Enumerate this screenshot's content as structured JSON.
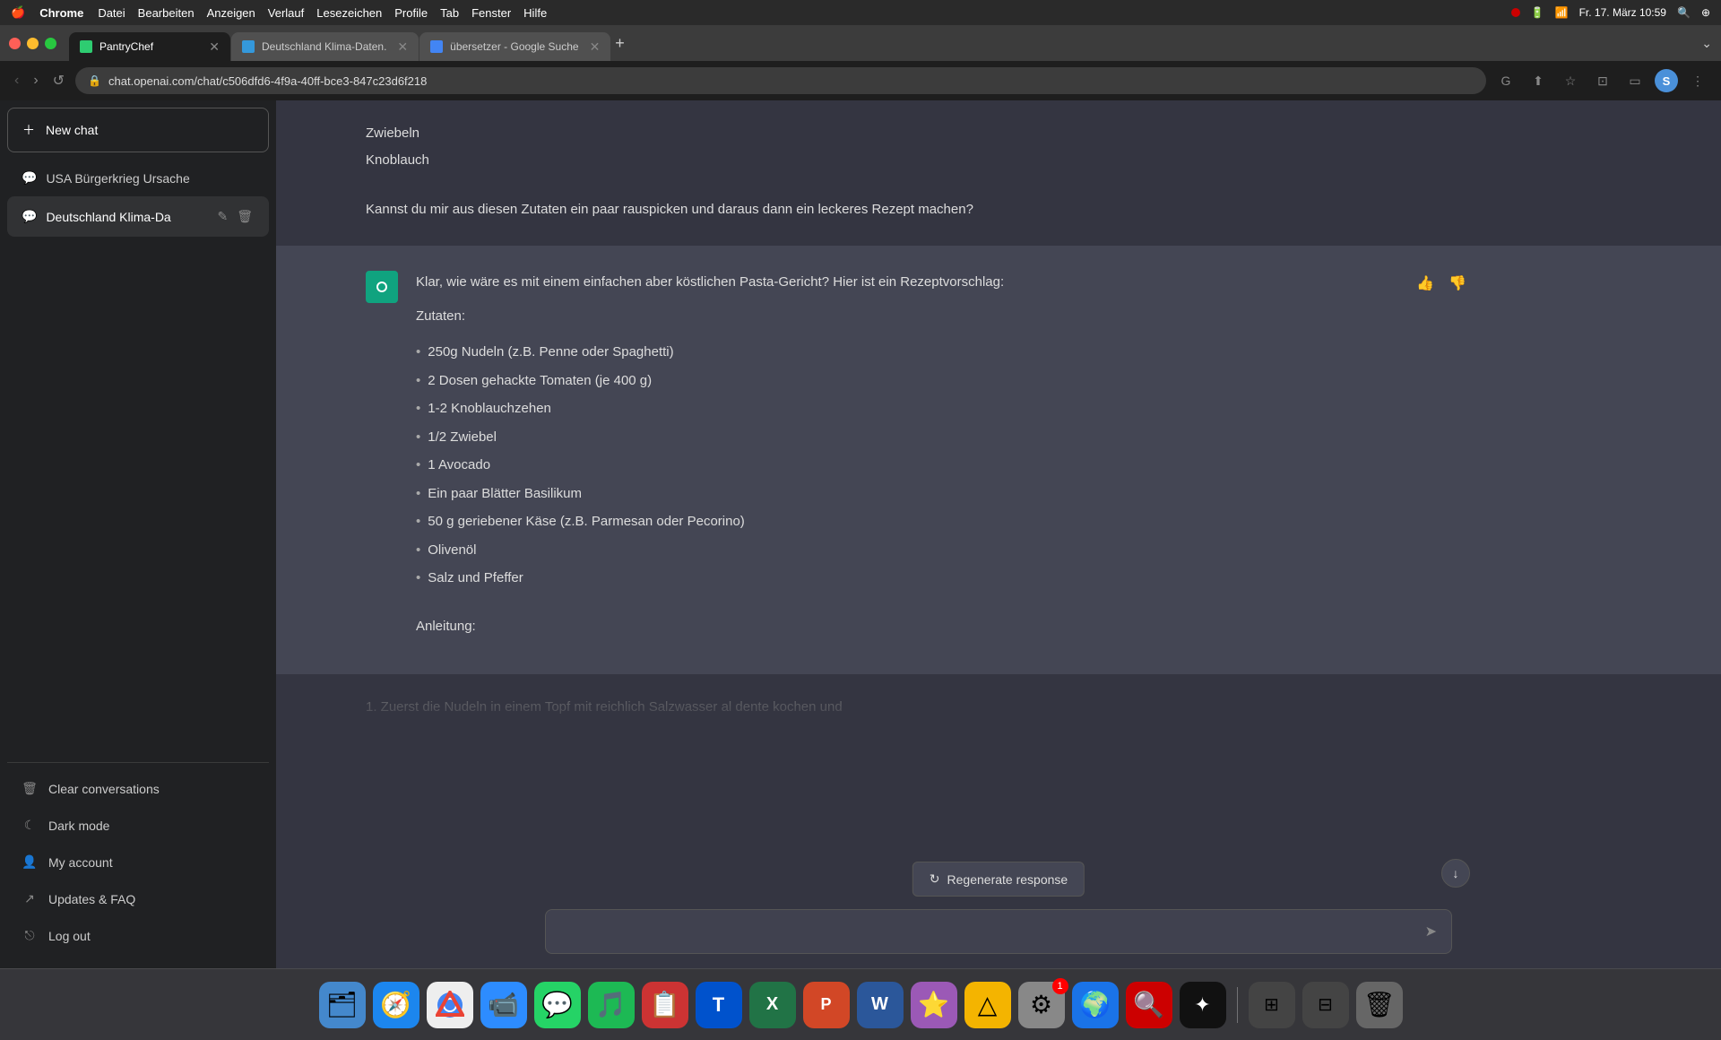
{
  "menubar": {
    "apple": "🍎",
    "browser_label": "Chrome",
    "menu_items": [
      "Datei",
      "Bearbeiten",
      "Anzeigen",
      "Verlauf",
      "Lesezeichen",
      "Profile",
      "Tab",
      "Fenster",
      "Hilfe"
    ],
    "time": "Fr. 17. März  10:59",
    "right_icons": [
      "battery_icon",
      "wifi_icon",
      "search_icon",
      "control_icon"
    ]
  },
  "tabs": [
    {
      "id": "tab-pantry",
      "title": "PantryChef",
      "active": true,
      "favicon_color": "#2ecc71"
    },
    {
      "id": "tab-de",
      "title": "Deutschland Klima-Daten.",
      "active": false,
      "favicon_color": "#3498db"
    },
    {
      "id": "tab-translate",
      "title": "übersetzer - Google Suche",
      "active": false,
      "favicon_color": "#4285f4"
    }
  ],
  "omnibar": {
    "url": "chat.openai.com/chat/c506dfd6-4f9a-40ff-bce3-847c23d6f218",
    "profile_initial": "S"
  },
  "sidebar": {
    "new_chat_label": "New chat",
    "chats": [
      {
        "id": "chat-1",
        "title": "USA Bürgerkrieg Ursache",
        "active": false
      },
      {
        "id": "chat-2",
        "title": "Deutschland Klima-Da",
        "active": true
      }
    ],
    "menu_items": [
      {
        "id": "clear-conversations",
        "label": "Clear conversations",
        "icon": "🗑"
      },
      {
        "id": "dark-mode",
        "label": "Dark mode",
        "icon": "☾"
      },
      {
        "id": "my-account",
        "label": "My account",
        "icon": "👤"
      },
      {
        "id": "updates-faq",
        "label": "Updates & FAQ",
        "icon": "↗"
      },
      {
        "id": "log-out",
        "label": "Log out",
        "icon": "⎋"
      }
    ]
  },
  "chat": {
    "user_message_partial": {
      "line1": "Zwiebeln",
      "line2": "Knoblauch",
      "question": "Kannst du mir aus diesen Zutaten ein paar rauspicken und daraus dann ein leckeres Rezept machen?"
    },
    "ai_message": {
      "intro": "Klar, wie wäre es mit einem einfachen aber köstlichen Pasta-Gericht? Hier ist ein Rezeptvorschlag:",
      "zutaten_label": "Zutaten:",
      "ingredients": [
        "250g Nudeln (z.B. Penne oder Spaghetti)",
        "2 Dosen gehackte Tomaten (je 400 g)",
        "1-2 Knoblauchzehen",
        "1/2 Zwiebel",
        "1 Avocado",
        "Ein paar Blätter Basilikum",
        "50 g geriebener Käse (z.B. Parmesan oder Pecorino)",
        "Olivenöl",
        "Salz und Pfeffer"
      ],
      "anleitung_label": "Anleitung:",
      "step1_partial": "1.  Zuerst die Nudeln in einem Topf mit reichlich Salzwasser al dente kochen und"
    },
    "regenerate_label": "Regenerate response"
  },
  "input": {
    "placeholder": ""
  },
  "dock": {
    "icons": [
      {
        "id": "finder",
        "emoji": "🗂",
        "bg": "#4488cc"
      },
      {
        "id": "safari",
        "emoji": "🧭",
        "bg": "#1c86ee"
      },
      {
        "id": "chrome",
        "emoji": "🌐",
        "bg": "#fff"
      },
      {
        "id": "zoom",
        "emoji": "📹",
        "bg": "#2d8cff"
      },
      {
        "id": "whatsapp",
        "emoji": "💬",
        "bg": "#25d366"
      },
      {
        "id": "spotify",
        "emoji": "🎵",
        "bg": "#1db954"
      },
      {
        "id": "stacks",
        "emoji": "📋",
        "bg": "#cc4444"
      },
      {
        "id": "trello",
        "emoji": "☰",
        "bg": "#0052cc"
      },
      {
        "id": "excel",
        "emoji": "📊",
        "bg": "#217346"
      },
      {
        "id": "powerpoint",
        "emoji": "📊",
        "bg": "#d24726"
      },
      {
        "id": "word",
        "emoji": "📝",
        "bg": "#2b579a"
      },
      {
        "id": "star",
        "emoji": "⭐",
        "bg": "#9b59b6"
      },
      {
        "id": "drive",
        "emoji": "△",
        "bg": "#f4b400"
      },
      {
        "id": "settings",
        "emoji": "⚙",
        "bg": "#888",
        "badge": "1"
      },
      {
        "id": "globe",
        "emoji": "🌍",
        "bg": "#1a73e8"
      },
      {
        "id": "lens",
        "emoji": "🔍",
        "bg": "#cc0000"
      },
      {
        "id": "ai-thing",
        "emoji": "✦",
        "bg": "#222"
      },
      {
        "id": "separator",
        "emoji": "|",
        "bg": "transparent"
      },
      {
        "id": "desktop-mgr1",
        "emoji": "⊞",
        "bg": "#555"
      },
      {
        "id": "desktop-mgr2",
        "emoji": "⊟",
        "bg": "#555"
      },
      {
        "id": "trash",
        "emoji": "🗑",
        "bg": "#666"
      }
    ]
  }
}
